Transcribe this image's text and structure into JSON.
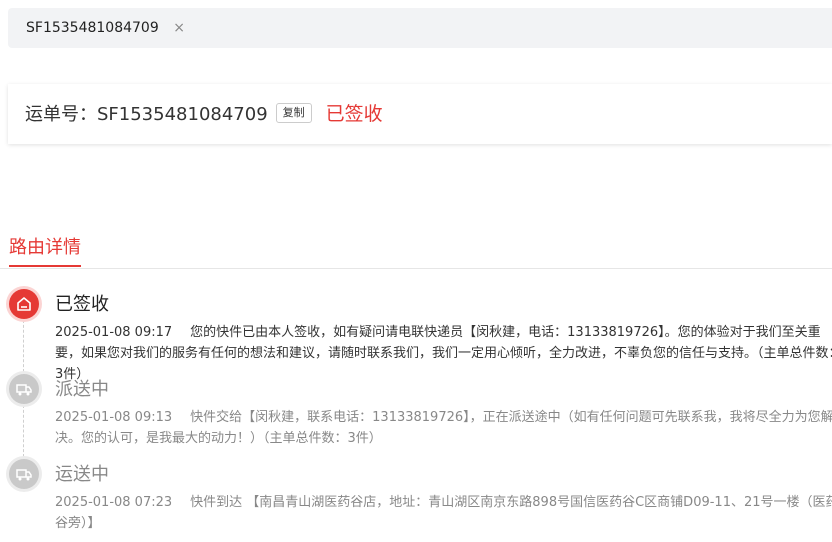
{
  "tabs": [
    {
      "label": "SF1535481084709",
      "close": "×"
    }
  ],
  "waybill": {
    "label": "运单号：",
    "number": "SF1535481084709",
    "copy_label": "复制",
    "status": "已签收"
  },
  "route": {
    "title": "路由详情",
    "events": [
      {
        "status": "已签收",
        "time": "2025-01-08 09:17",
        "text": "您的快件已由本人签收，如有疑问请电联快递员【闵秋建，电话：13133819726】。您的体验对于我们至关重要，如果您对我们的服务有任何的想法和建议，请随时联系我们，我们一定用心倾听，全力改进，不辜负您的信任与支持。（主单总件数：3件）",
        "icon": "home-icon",
        "active": true
      },
      {
        "status": "派送中",
        "time": "2025-01-08 09:13",
        "text": "快件交给【闵秋建，联系电话：13133819726】，正在派送途中（如有任何问题可先联系我，我将尽全力为您解决。您的认可，是我最大的动力！）（主单总件数：3件）",
        "icon": "delivery-truck-icon",
        "active": false
      },
      {
        "status": "运送中",
        "time": "2025-01-08 07:23",
        "text": "快件到达 【南昌青山湖医药谷店，地址：青山湖区南京东路898号国信医药谷C区商铺D09-11、21号一楼（医药谷旁）】",
        "icon": "transport-truck-icon",
        "active": false
      }
    ]
  },
  "colors": {
    "accent": "#e53935",
    "muted": "#888888"
  }
}
